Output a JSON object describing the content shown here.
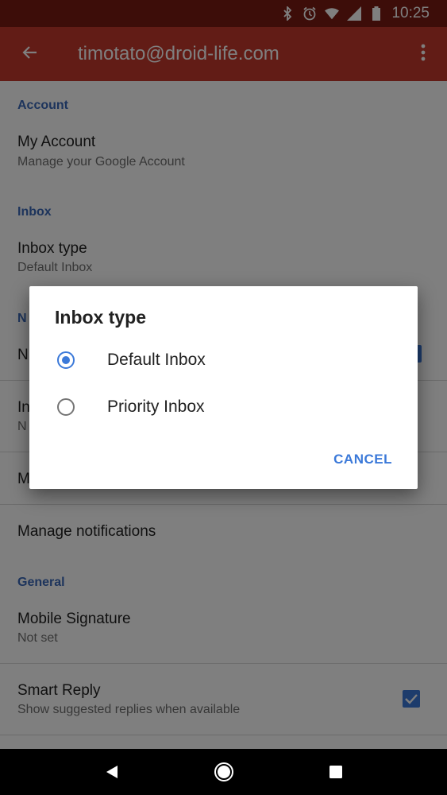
{
  "status_bar": {
    "time": "10:25",
    "icons": [
      "bluetooth-icon",
      "alarm-icon",
      "wifi-icon",
      "signal-icon",
      "battery-icon"
    ]
  },
  "app_bar": {
    "back_icon": "arrow-back-icon",
    "title": "timotato@droid-life.com",
    "menu_icon": "more-vert-icon"
  },
  "settings": {
    "account_header": "Account",
    "my_account_title": "My Account",
    "my_account_sub": "Manage your Google Account",
    "inbox_header": "Inbox",
    "inbox_type_title": "Inbox type",
    "inbox_type_sub": "Default Inbox",
    "notifications_header_partial": "N",
    "notifications_row_partial": "N",
    "inbox_categories_partial": "In",
    "inbox_categories_sub_partial": "N",
    "manage_labels_partial": "M",
    "manage_notifications_title": "Manage notifications",
    "general_header": "General",
    "mobile_signature_title": "Mobile Signature",
    "mobile_signature_sub": "Not set",
    "smart_reply_title": "Smart Reply",
    "smart_reply_sub": "Show suggested replies when available",
    "smart_reply_checked": true
  },
  "dialog": {
    "title": "Inbox type",
    "options": [
      {
        "label": "Default Inbox",
        "selected": true
      },
      {
        "label": "Priority Inbox",
        "selected": false
      }
    ],
    "cancel_label": "CANCEL"
  },
  "nav_bar": {
    "icons": [
      "back-triangle-icon",
      "home-circle-icon",
      "recents-square-icon"
    ]
  },
  "colors": {
    "status_bar": "#7a1a12",
    "app_bar": "#c5392d",
    "accent": "#3b79d9",
    "section_header": "#3b69b8"
  }
}
